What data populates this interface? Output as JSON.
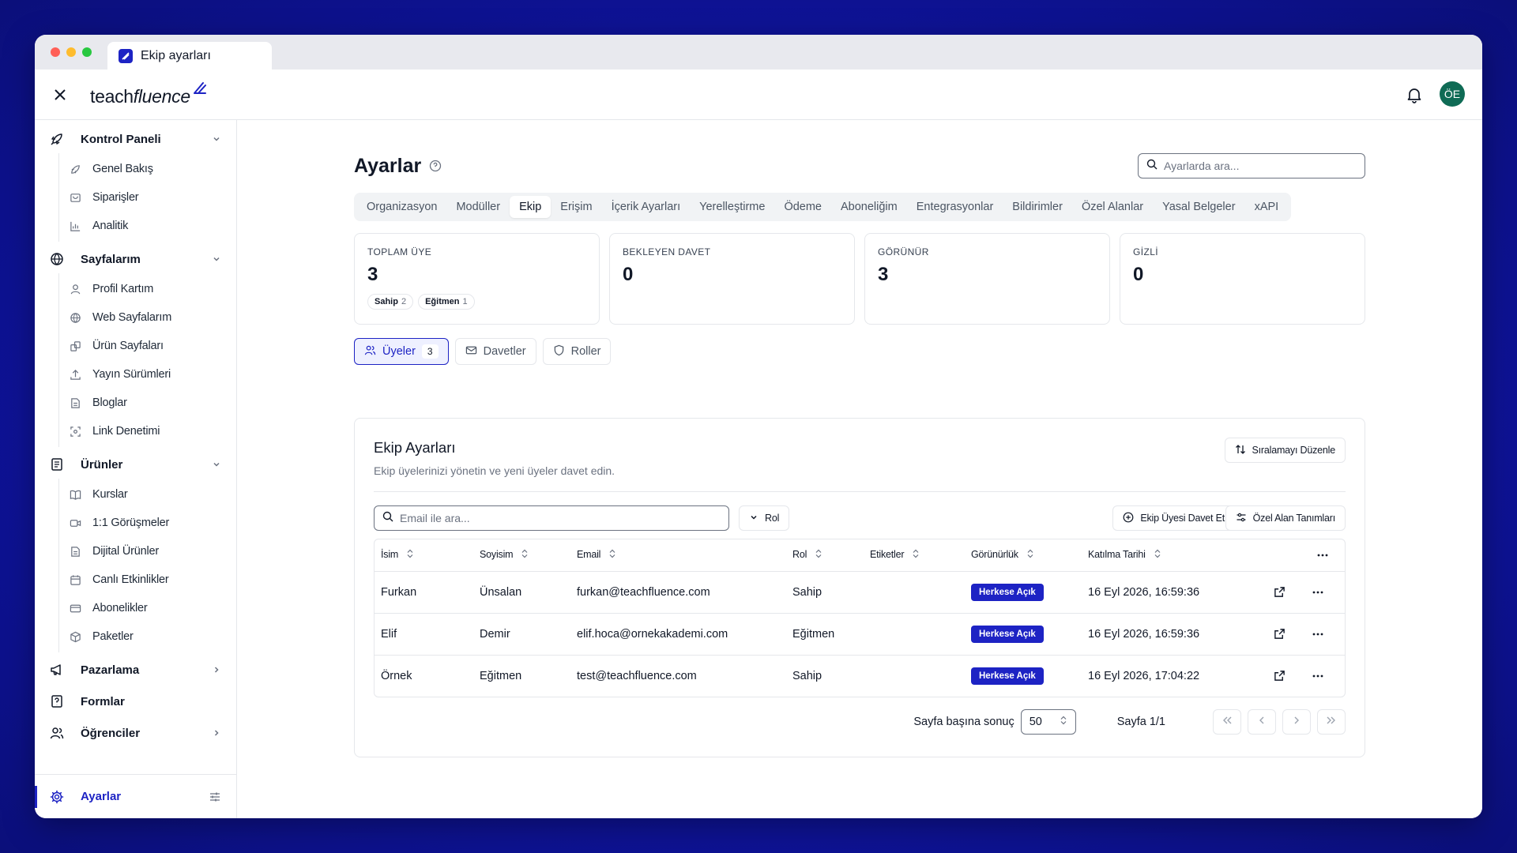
{
  "browser": {
    "tab_title": "Ekip ayarları"
  },
  "header": {
    "logo_bold": "teach",
    "logo_italic": "fluence",
    "avatar_initials": "ÖE"
  },
  "sidebar": {
    "groups": [
      {
        "label": "Kontrol Paneli",
        "icon": "rocket-icon",
        "items": [
          "Genel Bakış",
          "Siparişler",
          "Analitik"
        ]
      },
      {
        "label": "Sayfalarım",
        "icon": "globe-icon",
        "items": [
          "Profil Kartım",
          "Web Sayfalarım",
          "Ürün Sayfaları",
          "Yayın Sürümleri",
          "Bloglar",
          "Link Denetimi"
        ]
      },
      {
        "label": "Ürünler",
        "icon": "document-icon",
        "items": [
          "Kurslar",
          "1:1 Görüşmeler",
          "Dijital Ürünler",
          "Canlı Etkinlikler",
          "Abonelikler",
          "Paketler"
        ]
      },
      {
        "label": "Pazarlama",
        "icon": "megaphone-icon"
      },
      {
        "label": "Formlar",
        "icon": "form-icon"
      },
      {
        "label": "Öğrenciler",
        "icon": "users-icon"
      }
    ],
    "footer_label": "Ayarlar"
  },
  "page": {
    "title": "Ayarlar",
    "search_placeholder": "Ayarlarda ara...",
    "tabs": [
      "Organizasyon",
      "Modüller",
      "Ekip",
      "Erişim",
      "İçerik Ayarları",
      "Yerelleştirme",
      "Ödeme",
      "Aboneliğim",
      "Entegrasyonlar",
      "Bildirimler",
      "Özel Alanlar",
      "Yasal Belgeler",
      "xAPI"
    ],
    "active_tab": "Ekip"
  },
  "stats": [
    {
      "label": "TOPLAM ÜYE",
      "value": "3"
    },
    {
      "label": "BEKLEYEN DAVET",
      "value": "0"
    },
    {
      "label": "GÖRÜNÜR",
      "value": "3"
    },
    {
      "label": "GİZLİ",
      "value": "0"
    }
  ],
  "role_badges": [
    {
      "name": "Sahip",
      "count": "2"
    },
    {
      "name": "Eğitmen",
      "count": "1"
    }
  ],
  "subtabs": {
    "members": "Üyeler",
    "members_count": "3",
    "invites": "Davetler",
    "roles": "Roller"
  },
  "card": {
    "title": "Ekip Ayarları",
    "description": "Ekip üyelerinizi yönetin ve yeni üyeler davet edin.",
    "sort_button": "Sıralamayı Düzenle",
    "email_placeholder": "Email ile ara...",
    "role_filter": "Rol",
    "invite_button": "Ekip Üyesi Davet Et",
    "custom_fields_button": "Özel Alan Tanımları"
  },
  "table": {
    "columns": [
      "İsim",
      "Soyisim",
      "Email",
      "Rol",
      "Etiketler",
      "Görünürlük",
      "Katılma Tarihi"
    ],
    "rows": [
      {
        "first": "Furkan",
        "last": "Ünsalan",
        "email": "furkan@teachfluence.com",
        "role": "Sahip",
        "tags": "",
        "visibility": "Herkese Açık",
        "joined": "16 Eyl 2026, 16:59:36"
      },
      {
        "first": "Elif",
        "last": "Demir",
        "email": "elif.hoca@ornekakademi.com",
        "role": "Eğitmen",
        "tags": "",
        "visibility": "Herkese Açık",
        "joined": "16 Eyl 2026, 16:59:36"
      },
      {
        "first": "Örnek",
        "last": "Eğitmen",
        "email": "test@teachfluence.com",
        "role": "Sahip",
        "tags": "",
        "visibility": "Herkese Açık",
        "joined": "16 Eyl 2026, 17:04:22"
      }
    ]
  },
  "pagination": {
    "per_page_label": "Sayfa başına sonuç",
    "per_page_value": "50",
    "page_info": "Sayfa 1/1"
  },
  "colors": {
    "accent": "#1d23c4",
    "avatar": "#0f6b55"
  }
}
